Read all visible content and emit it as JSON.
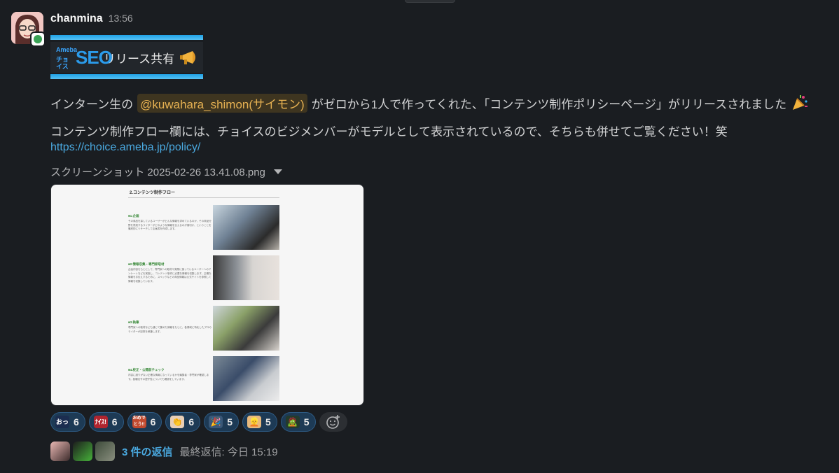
{
  "message": {
    "username": "chanmina",
    "timestamp": "13:56",
    "banner": {
      "logo_line1": "Ameba",
      "logo_line2": "チョイス",
      "logo_seo": "SEO",
      "title": "リリース共有"
    },
    "line1": {
      "prefix": "インターン生の",
      "mention": "@kuwahara_shimon(サイモン)",
      "suffix": "がゼロから1人で作ってくれた、「コンテンツ制作ポリシーページ」がリリースされました"
    },
    "line2": "コンテンツ制作フロー欄には、チョイスのビジメンバーがモデルとして表示されているので、そちらも併せてご覧ください！笑",
    "link": "https://choice.ameba.jp/policy/",
    "file_name": "スクリーンショット 2025-02-26 13.41.08.png",
    "screenshot": {
      "title": "2.コンテンツ制作フロー",
      "steps": [
        {
          "heading": "■1.企画",
          "text": "その商品を探しているユーザーがどんな情報を求めているのか、その商品分野を熟知するライターがどのような情報を伝えるのが適切か、ということを徹底的にリサーチして企画書を作成します。"
        },
        {
          "heading": "■2.情報収集・専門家取材",
          "text": "企画内容をもとにして、専門家への取材や実際に使っているユーザーへのアンケートなどを実施し、コンテンツ制作に必要な情報を収集します。正確な情報をお伝えするために、スペックなどの商品情報は公式サイトを参照して情報を収集しています。"
        },
        {
          "heading": "■3.執筆",
          "text": "専門家への取材なども通じて集めた情報をもとに、各領域に特化したプロのライターが記事を執筆します。"
        },
        {
          "heading": "■4.校正・公開前チェック",
          "text": "内容に誤りがない正確な情報になっているかを編集者・専門家が確認します。各種法令の遵守性についても確認をしています。"
        }
      ]
    },
    "reactions": [
      {
        "emoji_text": "おっ",
        "count": "6",
        "color": "#1b2d50"
      },
      {
        "emoji_text": "ﾅｲｽ!",
        "count": "6",
        "color": "#b0252f"
      },
      {
        "emoji_text": "おめでとう!!",
        "count": "6",
        "color": "#c2492e"
      },
      {
        "emoji_text": "👏",
        "count": "6",
        "color": "#e9cfb6"
      },
      {
        "emoji_text": "🎉",
        "count": "5",
        "color": "#3a5878"
      },
      {
        "emoji_text": "👱",
        "count": "5",
        "color": "#e8b97d"
      },
      {
        "emoji_text": "🧟",
        "count": "5",
        "color": "#243b2c"
      }
    ],
    "thread": {
      "reply_count": "3 件の返信",
      "last_reply": "最終返信: 今日 15:19"
    }
  }
}
